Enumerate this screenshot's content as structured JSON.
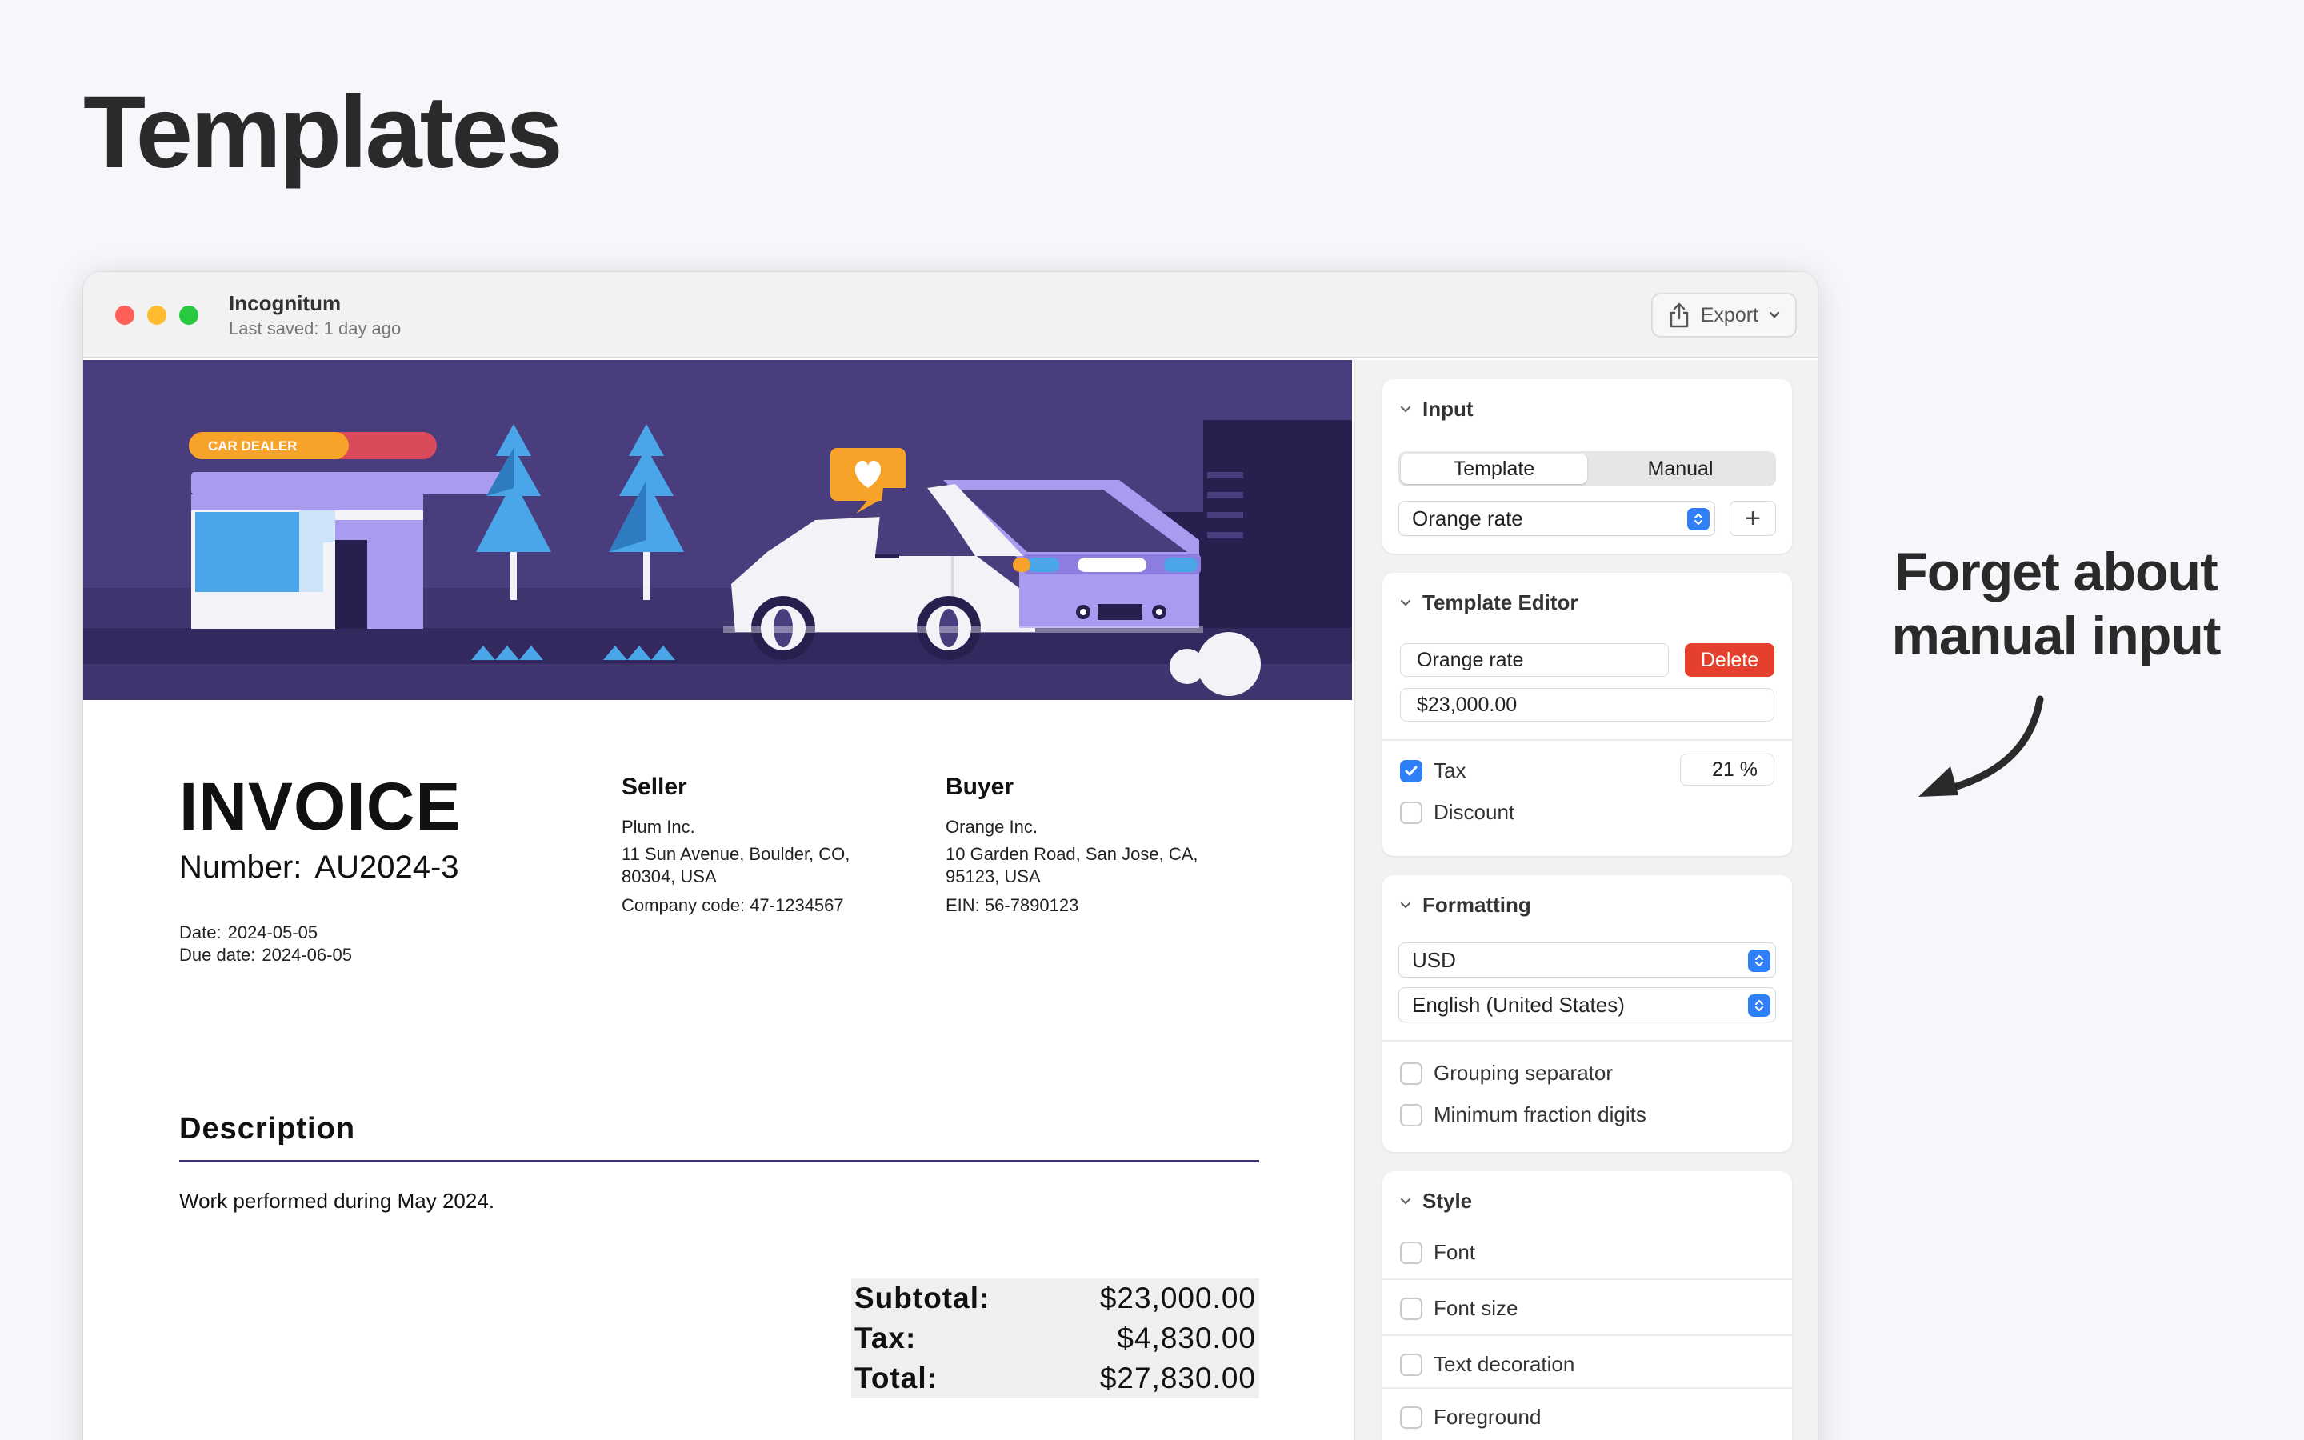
{
  "page": {
    "title": "Templates",
    "tagline_line1": "Forget about",
    "tagline_line2": "manual input"
  },
  "window": {
    "doc_name": "Incognitum",
    "last_saved": "Last saved: 1 day ago",
    "export_label": "Export"
  },
  "banner": {
    "sign_text": "CAR DEALER"
  },
  "invoice": {
    "title": "INVOICE",
    "number_label": "Number:",
    "number_value": "AU2024-3",
    "date_label": "Date:",
    "date_value": "2024-05-05",
    "due_label": "Due date:",
    "due_value": "2024-06-05",
    "seller": {
      "heading": "Seller",
      "name": "Plum Inc.",
      "address_line1": "11 Sun Avenue, Boulder, CO,",
      "address_line2": "80304, USA",
      "code": "Company code: 47-1234567"
    },
    "buyer": {
      "heading": "Buyer",
      "name": "Orange Inc.",
      "address_line1": "10 Garden Road, San Jose, CA,",
      "address_line2": "95123, USA",
      "code": "EIN: 56-7890123"
    },
    "description_heading": "Description",
    "description_text": "Work performed during May 2024.",
    "totals": [
      {
        "label": "Subtotal:",
        "value": "$23,000.00"
      },
      {
        "label": "Tax:",
        "value": "$4,830.00"
      },
      {
        "label": "Total:",
        "value": "$27,830.00"
      }
    ]
  },
  "sidebar": {
    "input": {
      "heading": "Input",
      "tabs": [
        "Template",
        "Manual"
      ],
      "active_tab": "Template",
      "template_select": "Orange rate",
      "add_label": "+"
    },
    "template_editor": {
      "heading": "Template Editor",
      "name_value": "Orange rate",
      "delete_label": "Delete",
      "amount_value": "$23,000.00",
      "tax_label": "Tax",
      "tax_checked": true,
      "tax_value": "21 %",
      "discount_label": "Discount",
      "discount_checked": false
    },
    "formatting": {
      "heading": "Formatting",
      "currency": "USD",
      "locale": "English (United States)",
      "grouping_label": "Grouping separator",
      "min_fraction_label": "Minimum fraction digits"
    },
    "style": {
      "heading": "Style",
      "options": [
        "Font",
        "Font size",
        "Text decoration",
        "Foreground"
      ]
    }
  },
  "colors": {
    "banner_bg": "#4a3d7e",
    "accent_blue": "#2f7ff6",
    "delete_red": "#e5402d",
    "divider_navy": "#3b3470"
  }
}
